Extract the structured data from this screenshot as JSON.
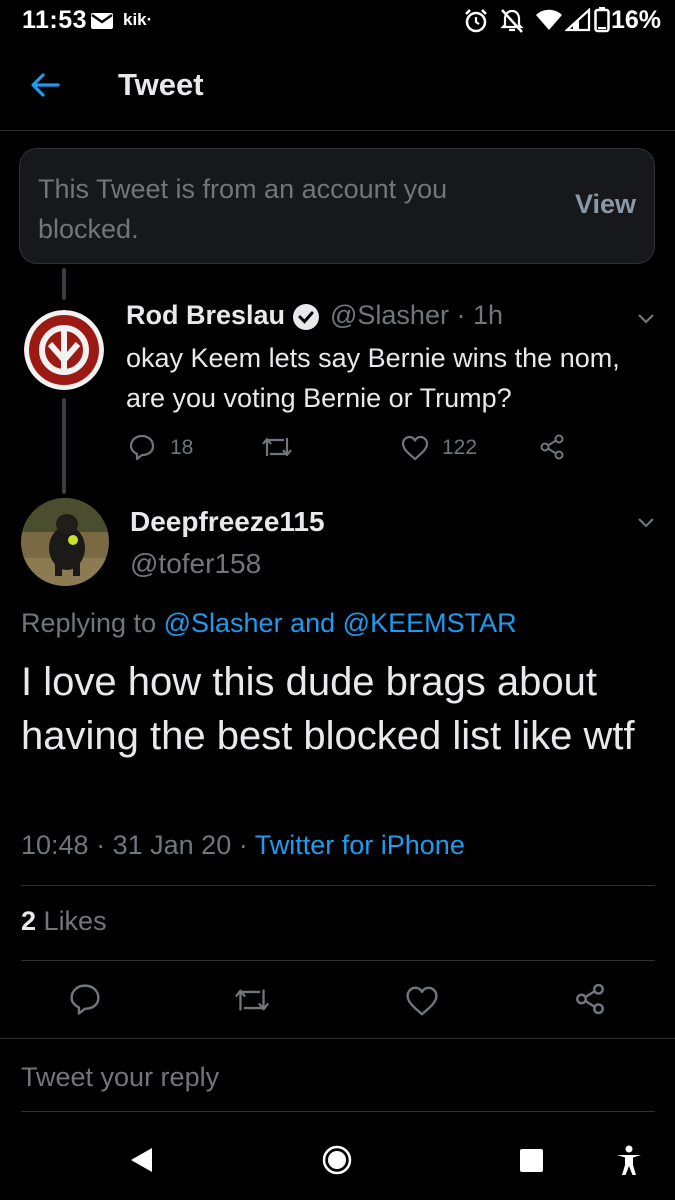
{
  "status_bar": {
    "time": "11:53",
    "app_label": "kik·",
    "battery": "16%",
    "icons": [
      "mail-icon",
      "kik-icon",
      "alarm-icon",
      "bell-off-icon",
      "wifi-icon",
      "signal-icon",
      "battery-icon"
    ]
  },
  "header": {
    "title": "Tweet",
    "back_icon": "arrow-left-icon"
  },
  "blocked_notice": {
    "text": "This Tweet is from an account you blocked.",
    "view_label": "View"
  },
  "quoted_tweet": {
    "name": "Rod Breslau",
    "verified": true,
    "handle": "@Slasher",
    "separator": "·",
    "time": "1h",
    "text": "okay Keem lets say Bernie wins the nom, are you voting Bernie or Trump?",
    "reply_count": "18",
    "like_count": "122"
  },
  "main_tweet": {
    "name": "Deepfreeze115",
    "handle": "@tofer158",
    "replying_prefix": "Replying to",
    "replying_to_1": "@Slasher",
    "replying_and": "and",
    "replying_to_2": "@KEEMSTAR",
    "text": "I love how this dude brags about having the best blocked list like wtf",
    "time": "10:48",
    "dot": "·",
    "date": "31 Jan 20",
    "source": "Twitter for iPhone",
    "likes_count": "2",
    "likes_label": "Likes"
  },
  "reply_box": {
    "placeholder": "Tweet your reply"
  },
  "colors": {
    "background": "#000000",
    "accent": "#1d9bf0",
    "muted": "#71767b",
    "text": "#e7e9ea"
  }
}
